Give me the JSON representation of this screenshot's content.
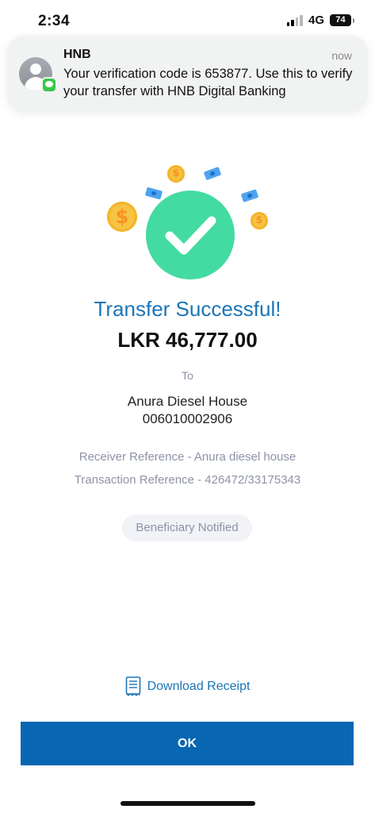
{
  "status_bar": {
    "time": "2:34",
    "network": "4G",
    "battery": "74"
  },
  "notification": {
    "app": "HNB",
    "time": "now",
    "message": "Your verification code is 653877. Use this to verify your transfer with HNB Digital Banking"
  },
  "result": {
    "title": "Transfer Successful!",
    "amount": "LKR 46,777.00",
    "to_label": "To",
    "payee_name": "Anura Diesel House",
    "payee_account": "006010002906",
    "receiver_reference": "Receiver Reference - Anura diesel house",
    "transaction_reference": "Transaction Reference - 426472/33175343",
    "badge": "Beneficiary Notified"
  },
  "actions": {
    "download_label": "Download Receipt",
    "ok_label": "OK"
  },
  "colors": {
    "accent": "#1b75b7",
    "button": "#0866b2",
    "success": "#43dba1"
  },
  "icons": {
    "coin": "$"
  }
}
